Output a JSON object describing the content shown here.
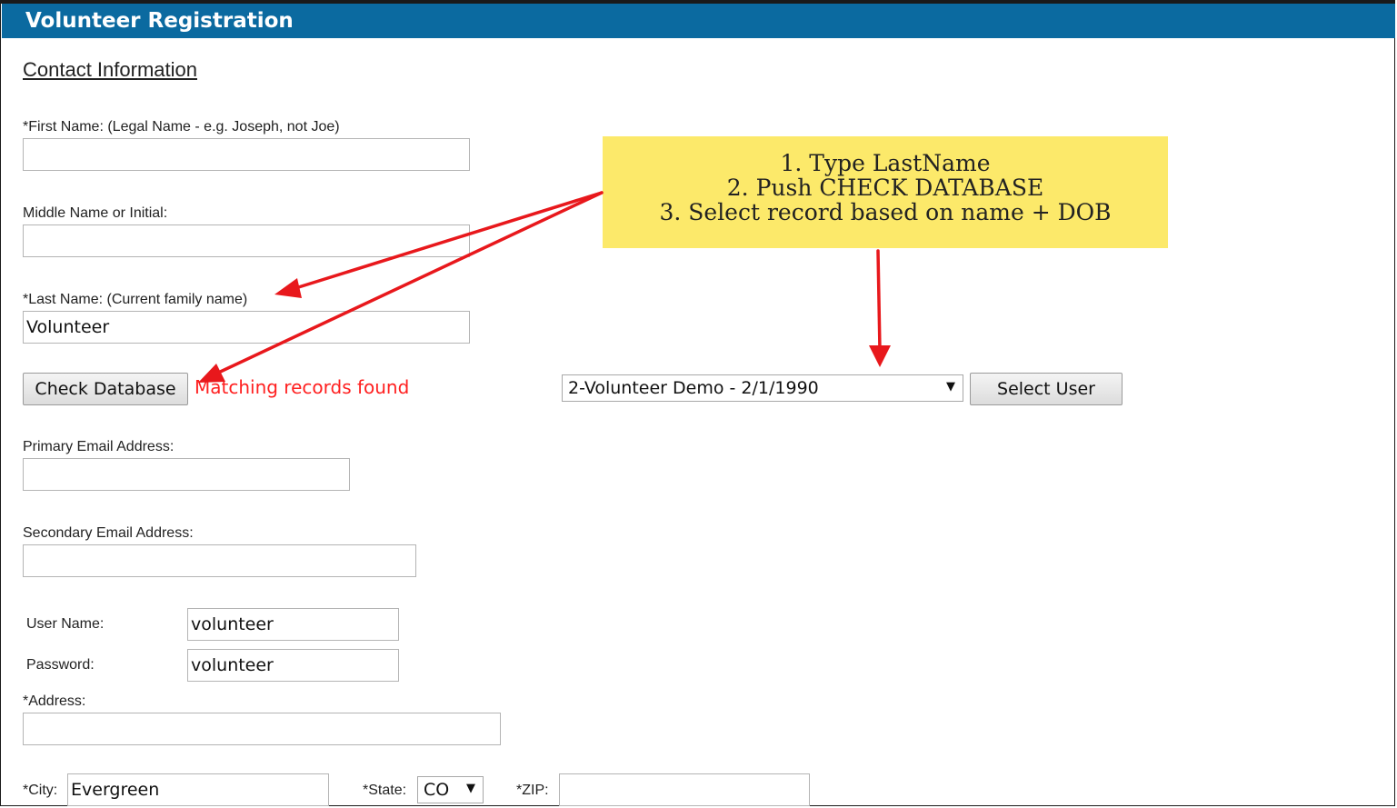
{
  "header": {
    "title": "Volunteer Registration"
  },
  "section": {
    "title": "Contact Information"
  },
  "fields": {
    "first_name": {
      "label": "*First Name: (Legal Name - e.g. Joseph, not Joe)",
      "value": ""
    },
    "middle_name": {
      "label": "Middle Name or Initial:",
      "value": ""
    },
    "last_name": {
      "label": "*Last Name: (Current family name)",
      "value": "Volunteer"
    },
    "primary_email": {
      "label": "Primary Email Address:",
      "value": ""
    },
    "secondary_email": {
      "label": "Secondary Email Address:",
      "value": ""
    },
    "user_name": {
      "label": "User Name:",
      "value": "volunteer"
    },
    "password": {
      "label": "Password:",
      "value": "volunteer"
    },
    "address": {
      "label": "*Address:",
      "value": ""
    },
    "city": {
      "label": "*City:",
      "value": "Evergreen"
    },
    "state": {
      "label": "*State:",
      "value": "CO"
    },
    "zip": {
      "label": "*ZIP:",
      "value": ""
    }
  },
  "check": {
    "button_label": "Check Database",
    "message": "Matching records found"
  },
  "user_select": {
    "selected": "2-Volunteer Demo - 2/1/1990",
    "button_label": "Select User"
  },
  "callout": {
    "lines": [
      "1. Type LastName",
      "2. Push CHECK DATABASE",
      "3. Select record based on name + DOB"
    ]
  },
  "icons": {
    "dropdown": "chevron-down-icon"
  },
  "colors": {
    "header": "#0b6aa0",
    "message": "#ff2020",
    "callout": "#fce96a",
    "arrow": "#e8181c"
  }
}
